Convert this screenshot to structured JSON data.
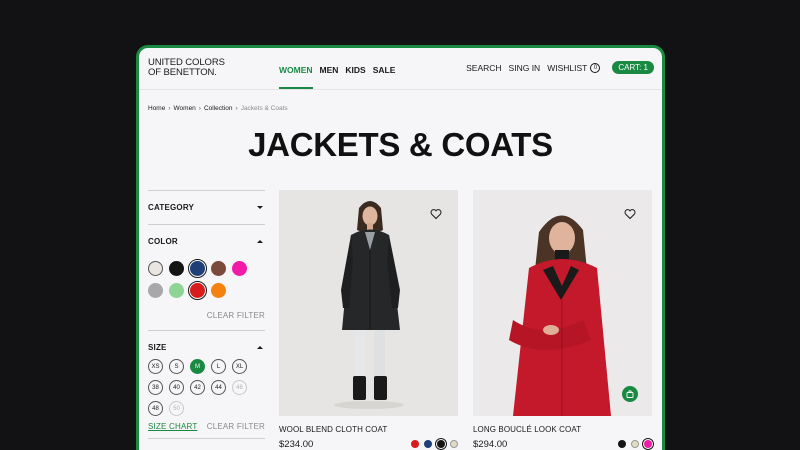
{
  "logo": {
    "line1": "UNITED COLORS",
    "line2": "OF BENETTON."
  },
  "nav": [
    {
      "label": "WOMEN",
      "active": true
    },
    {
      "label": "MEN",
      "active": false
    },
    {
      "label": "KIDS",
      "active": false
    },
    {
      "label": "SALE",
      "active": false
    }
  ],
  "header_right": {
    "search": "SEARCH",
    "signin": "SING IN",
    "wishlist": "WISHLIST",
    "wishlist_count": "0",
    "cart": "CART: 1"
  },
  "breadcrumb": [
    "Home",
    "Women",
    "Collection",
    "Jackets & Coats"
  ],
  "page_title": "JACKETS & COATS",
  "filters": {
    "category": {
      "label": "CATEGORY",
      "expanded": false
    },
    "color": {
      "label": "COLOR",
      "expanded": true,
      "swatches": [
        {
          "color": "#ebe5e2",
          "selected": false
        },
        {
          "color": "#141414",
          "selected": false
        },
        {
          "color": "#1f3f78",
          "selected": true
        },
        {
          "color": "#7a4a3a",
          "selected": false
        },
        {
          "color": "#f01ca8",
          "selected": false
        },
        {
          "color": "#a8a8ab",
          "selected": false
        },
        {
          "color": "#8ed495",
          "selected": false
        },
        {
          "color": "#d81c1c",
          "selected": true
        },
        {
          "color": "#f5820f",
          "selected": false
        }
      ],
      "clear": "CLEAR FILTER"
    },
    "size": {
      "label": "SIZE",
      "expanded": true,
      "options": [
        {
          "label": "XS",
          "state": "normal"
        },
        {
          "label": "S",
          "state": "normal"
        },
        {
          "label": "M",
          "state": "selected"
        },
        {
          "label": "L",
          "state": "normal"
        },
        {
          "label": "XL",
          "state": "normal"
        },
        {
          "label": "38",
          "state": "normal"
        },
        {
          "label": "40",
          "state": "normal"
        },
        {
          "label": "42",
          "state": "normal"
        },
        {
          "label": "44",
          "state": "normal"
        },
        {
          "label": "46",
          "state": "disabled"
        },
        {
          "label": "48",
          "state": "normal"
        },
        {
          "label": "50",
          "state": "disabled"
        }
      ],
      "size_chart": "SIZE CHART",
      "clear": "CLEAR FILTER"
    }
  },
  "products": [
    {
      "name": "WOOL BLEND CLOTH COAT",
      "price": "$234.00",
      "colors": [
        {
          "color": "#d81c1c",
          "selected": false
        },
        {
          "color": "#1f3f78",
          "selected": false
        },
        {
          "color": "#141414",
          "selected": true
        },
        {
          "color": "#e2dcc4",
          "selected": false
        }
      ]
    },
    {
      "name": "LONG BOUCLÉ LOOK COAT",
      "price": "$294.00",
      "colors": [
        {
          "color": "#141414",
          "selected": false
        },
        {
          "color": "#e2dcc4",
          "selected": false
        },
        {
          "color": "#f01ca8",
          "selected": true
        }
      ]
    }
  ]
}
